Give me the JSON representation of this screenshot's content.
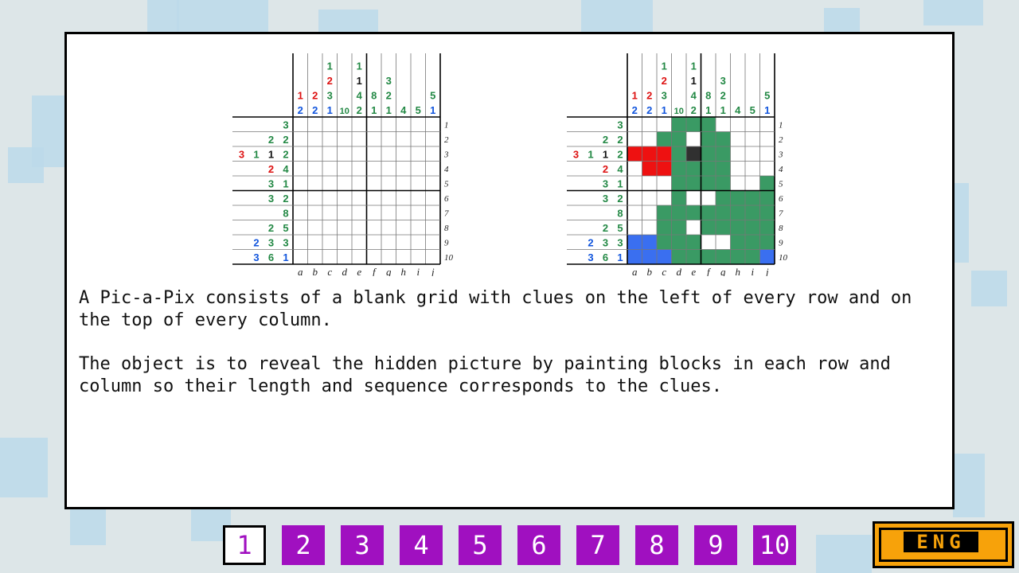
{
  "puzzle": {
    "col_clues": [
      [
        {
          "n": "1",
          "c": "#dd1111"
        },
        {
          "n": "2",
          "c": "#1155dd"
        }
      ],
      [
        {
          "n": "2",
          "c": "#dd1111"
        },
        {
          "n": "2",
          "c": "#1155dd"
        }
      ],
      [
        {
          "n": "1",
          "c": "#228844"
        },
        {
          "n": "2",
          "c": "#dd1111"
        },
        {
          "n": "3",
          "c": "#228844"
        },
        {
          "n": "1",
          "c": "#1155dd"
        }
      ],
      [
        {
          "n": "10",
          "c": "#228844"
        }
      ],
      [
        {
          "n": "1",
          "c": "#228844"
        },
        {
          "n": "1",
          "c": "#111111"
        },
        {
          "n": "4",
          "c": "#228844"
        },
        {
          "n": "2",
          "c": "#228844"
        }
      ],
      [
        {
          "n": "8",
          "c": "#228844"
        },
        {
          "n": "1",
          "c": "#228844"
        }
      ],
      [
        {
          "n": "3",
          "c": "#228844"
        },
        {
          "n": "2",
          "c": "#228844"
        },
        {
          "n": "1",
          "c": "#228844"
        }
      ],
      [
        {
          "n": "4",
          "c": "#228844"
        }
      ],
      [
        {
          "n": "5",
          "c": "#228844"
        }
      ],
      [
        {
          "n": "5",
          "c": "#228844"
        },
        {
          "n": "1",
          "c": "#1155dd"
        }
      ]
    ],
    "row_clues": [
      [
        {
          "n": "3",
          "c": "#228844"
        }
      ],
      [
        {
          "n": "2",
          "c": "#228844"
        },
        {
          "n": "2",
          "c": "#228844"
        }
      ],
      [
        {
          "n": "3",
          "c": "#dd1111"
        },
        {
          "n": "1",
          "c": "#228844"
        },
        {
          "n": "1",
          "c": "#111111"
        },
        {
          "n": "2",
          "c": "#228844"
        }
      ],
      [
        {
          "n": "2",
          "c": "#dd1111"
        },
        {
          "n": "4",
          "c": "#228844"
        }
      ],
      [
        {
          "n": "3",
          "c": "#228844"
        },
        {
          "n": "1",
          "c": "#228844"
        }
      ],
      [
        {
          "n": "3",
          "c": "#228844"
        },
        {
          "n": "2",
          "c": "#228844"
        }
      ],
      [
        {
          "n": "8",
          "c": "#228844"
        }
      ],
      [
        {
          "n": "2",
          "c": "#228844"
        },
        {
          "n": "5",
          "c": "#228844"
        }
      ],
      [
        {
          "n": "2",
          "c": "#1155dd"
        },
        {
          "n": "3",
          "c": "#228844"
        },
        {
          "n": "3",
          "c": "#228844"
        }
      ],
      [
        {
          "n": "3",
          "c": "#1155dd"
        },
        {
          "n": "6",
          "c": "#228844"
        },
        {
          "n": "1",
          "c": "#1155dd"
        }
      ]
    ],
    "col_labels": [
      "a",
      "b",
      "c",
      "d",
      "e",
      "f",
      "g",
      "h",
      "i",
      "j"
    ],
    "row_labels": [
      "1",
      "2",
      "3",
      "4",
      "5",
      "6",
      "7",
      "8",
      "9",
      "10"
    ],
    "palette": {
      "G": "#3a9a64",
      "R": "#ee1111",
      "K": "#303030",
      "B": "#3a6ff0",
      "W": "#ffffff"
    },
    "solution": [
      "...GGG....",
      "..GGWGG...",
      "RRRGKGG...",
      ".RRGGGG...",
      "...GGGGW.G",
      "...GWWGGGG",
      "..GGGGGGGG",
      "..GGWGGGGG",
      "BBGGGWWGGG",
      "BBBGGGGGGB"
    ]
  },
  "description": {
    "p1": "A Pic-a-Pix consists of a blank grid with clues on the left of every row and on the top of every column.",
    "p2": "The object is to reveal the hidden picture by painting blocks in each row and column so their length and sequence corresponds to the clues."
  },
  "pager": {
    "pages": [
      "1",
      "2",
      "3",
      "4",
      "5",
      "6",
      "7",
      "8",
      "9",
      "10"
    ],
    "active_index": 0
  },
  "language": {
    "label": "ENG"
  }
}
